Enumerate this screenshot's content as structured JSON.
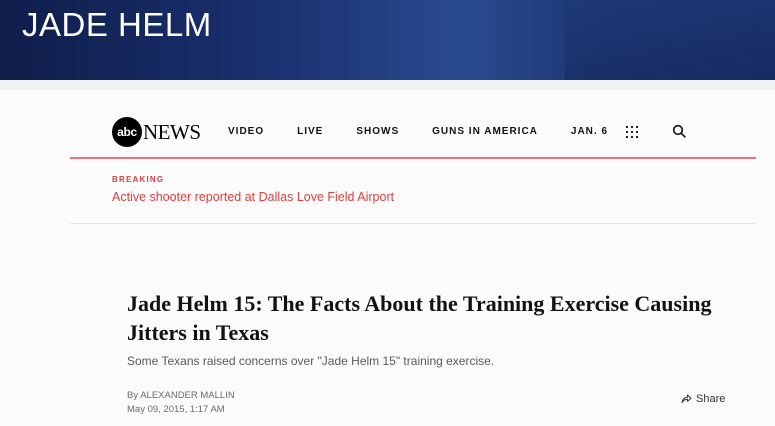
{
  "banner": {
    "title": "JADE HELM"
  },
  "header": {
    "logo_circle": "abc",
    "logo_text": "NEWS",
    "nav": [
      "VIDEO",
      "LIVE",
      "SHOWS",
      "GUNS IN AMERICA",
      "JAN. 6"
    ],
    "icons": [
      "apps-grid-icon",
      "search-icon"
    ]
  },
  "breaking": {
    "label": "BREAKING",
    "link": "Active shooter reported at Dallas Love Field Airport"
  },
  "article": {
    "headline": "Jade Helm 15: The Facts About the Training Exercise Causing Jitters in Texas",
    "subhead": "Some Texans raised concerns over \"Jade Helm 15\" training exercise.",
    "byline": "By ALEXANDER MALLIN",
    "date": "May 09, 2015, 1:17 AM",
    "share_label": "Share"
  },
  "colors": {
    "accent_red": "#d94340",
    "banner_blue": "#1a3170",
    "rule_red": "#e8737a"
  }
}
